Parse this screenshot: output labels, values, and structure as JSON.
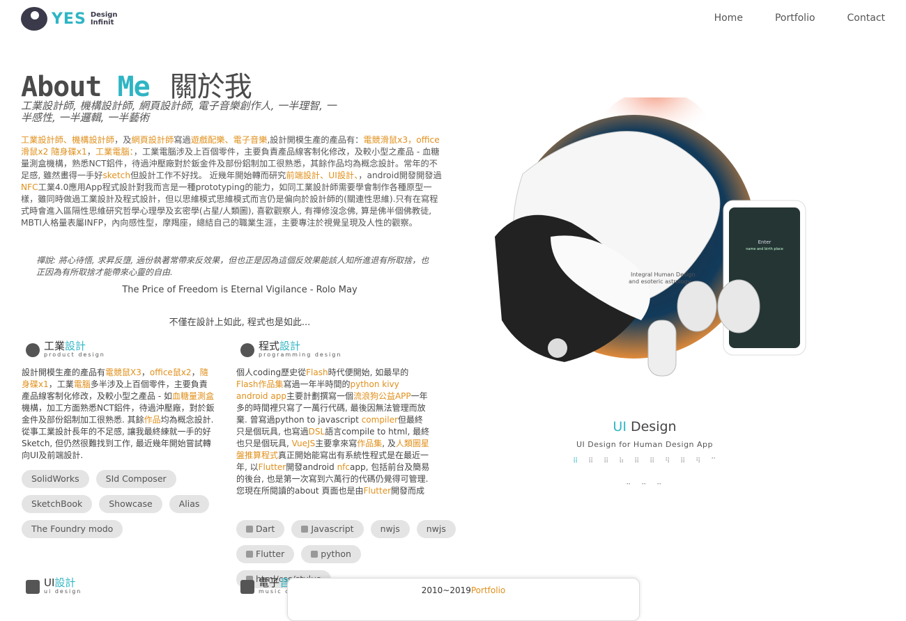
{
  "header": {
    "logo_text": "YES",
    "logo_sub1": "Design",
    "logo_sub2": "Infinit",
    "nav": [
      "Home",
      "Portfolio",
      "Contact"
    ]
  },
  "about": {
    "title_about": "About",
    "title_me": "Me",
    "title_zh": "關於我",
    "subtitle": "工業設計師, 機構設計師, 網頁設計師, 電子音樂創作人, 一半理智, 一半感性, 一半邏輯, 一半藝術",
    "intro": {
      "p1_hl1": "工業設計師、機構設計師",
      "p1_t1": "，及",
      "p1_hl2": "網頁設計師",
      "p1_t2": "寫過",
      "p1_hl3": "遊戲配樂、電子音樂",
      "p1_t3": ",設計開模生產的產品有：",
      "p1_hl4": "電競滑鼠x3，office滑鼠x2 隨身碟x1",
      "p1_t4": "，",
      "p1_hl5": "工業電腦：",
      "p1_t5": "，工業電腦涉及上百個零件，主要負責產品線客制化修改，及較小型之產品 - 血糖量測盒機構，熟悉NCT鋁件，待過沖壓廠對於鈑金件及部份鋁制加工很熟悉，其餘作品均為概念設計。常年的不足感, 雖然畫得一手好",
      "p1_hl6": "sketch",
      "p1_t6": "但設計工作不好找。 近幾年開始轉而研究",
      "p1_hl7": "前端設計、UI設計、",
      "p1_t7": "，android開發開發過",
      "p1_hl8": "NFC",
      "p1_t8": "工業4.0應用App程式設計對我而言是一種prototyping的能力，如同工業設計師需要學會制作各種原型一樣，雖同時做過工業設計及程式設計，但以思維模式思維模式而言仍是偏向於設計師的(關連性思維).只有在寫程式時會進入區隔性思維研究哲學心理學及玄密學(占星/人類圖), 喜歡觀察人, 有禪修沒念佛, 算是佛半個佛教徒, MBTI人格量表屬INFP，內向感性型，摩羯座，總結自己的職業生涯，主要專注於視覺呈現及人性的觀察。"
    },
    "quote": "禪說: 將心待悟, 求昇反墮, 過份執著常帶來反效果，但也正是因為這個反效果能該人知所進退有所取捨，也正因為有所取捨才能帶來心靈的自由.",
    "motto1": "The Price of Freedom is Eternal Vigilance - Rolo May",
    "motto2": "不僅在設計上如此, 程式也是如此..."
  },
  "industrial": {
    "title_a": "工業",
    "title_b": "設計",
    "sub": "product design",
    "t1": "設計開模生產的產品有",
    "h1": "電競鼠X3",
    "t2": "，",
    "h2": "office鼠x2",
    "t3": "，",
    "h3": "隨身碟x1",
    "t4": "，工業",
    "h4": "電腦",
    "t5": "多半涉及上百個零件，主要負責產品線客制化修改，及較小型之產品 - 如",
    "h5": "血糖量測盒",
    "t6": "機構，加工方面熟悉NCT鋁件，待過沖壓廠，對於鈑金件及部份鋁制加工很熟悉. 其餘",
    "h6": "作品",
    "t7": "均為概念設計. 從事工業設計長年的不足感, 讓我最終練就一手的好Sketch, 但仍然很難找到工作, 最近幾年開始嘗試轉向UI及前端設計.",
    "tags": [
      "SolidWorks",
      "SId Composer",
      "SketchBook",
      "Showcase",
      "Alias",
      "The Foundry modo"
    ]
  },
  "programming": {
    "title_a": "程式",
    "title_b": "設計",
    "sub": "programming design",
    "t1": "個人coding歷史從",
    "h1": "Flash",
    "t2": "時代便開始, 如最早的",
    "h2": "Flash作品集",
    "t3": "寫過一年半時間的",
    "h3": "python kivy android app",
    "t4": "主要計劃撰寫一個",
    "h4": "流浪狗公益APP",
    "t5": "一年多的時間裡只寫了一萬行代碼, 最後因無法管理而放棄. 曾寫過python to javascript ",
    "h5": "compiler",
    "t6": "但最終只是個玩具, 也寫過",
    "h6": "DSL",
    "t7": "語言compile to html, 最終也只是個玩具, ",
    "h7": "VueJS",
    "t8": "主要拿來寫",
    "h8": "作品集",
    "t9": ", 及",
    "h9": "人類圖星盤推算程式",
    "t10": "真正開始能寫出有系統性程式是在最近一年, 以",
    "h10": "Flutter",
    "t11": "開發android ",
    "h11": "nfc",
    "t12": "app, 包括前台及簡易的後台, 也是第一次寫到六萬行的代碼仍覺得可管理.您現在所閱讀的about 頁面也是由",
    "h12": "Flutter",
    "t13": "開發而成",
    "tags": [
      "Dart",
      "Javascript",
      "nwjs",
      "nwjs",
      "Flutter",
      "python",
      "html/css/stylus"
    ]
  },
  "ui_section": {
    "title_a": "UI",
    "title_b": "設計",
    "sub": "ui design"
  },
  "music_section": {
    "title_a": "電子",
    "title_b": "音",
    "sub": "music c"
  },
  "showcase": {
    "title_a": "UI",
    "title_b": "Design",
    "subtitle": "UI Design for Human Design App",
    "illus_text1": "Integral Human Design",
    "illus_text2": "and esoteric astrology",
    "phone_text1": "Enter",
    "phone_text2": "name and birth place"
  },
  "popup": {
    "years": "2010~2019",
    "link": "Portfolio"
  },
  "colors": {
    "accent": "#2fb5c4",
    "highlight": "#e0901c"
  }
}
